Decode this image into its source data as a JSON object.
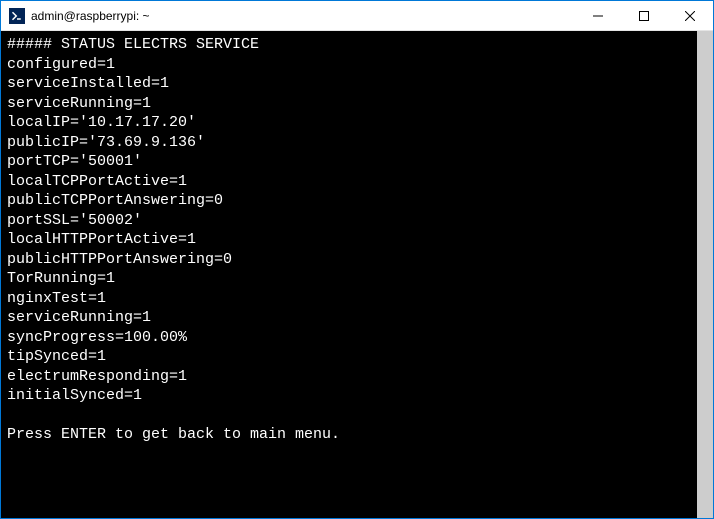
{
  "window": {
    "title": "admin@raspberrypi: ~"
  },
  "terminal": {
    "lines": [
      "##### STATUS ELECTRS SERVICE",
      "configured=1",
      "serviceInstalled=1",
      "serviceRunning=1",
      "localIP='10.17.17.20'",
      "publicIP='73.69.9.136'",
      "portTCP='50001'",
      "localTCPPortActive=1",
      "publicTCPPortAnswering=0",
      "portSSL='50002'",
      "localHTTPPortActive=1",
      "publicHTTPPortAnswering=0",
      "TorRunning=1",
      "nginxTest=1",
      "serviceRunning=1",
      "syncProgress=100.00%",
      "tipSynced=1",
      "electrumResponding=1",
      "initialSynced=1",
      "",
      "Press ENTER to get back to main menu."
    ]
  }
}
